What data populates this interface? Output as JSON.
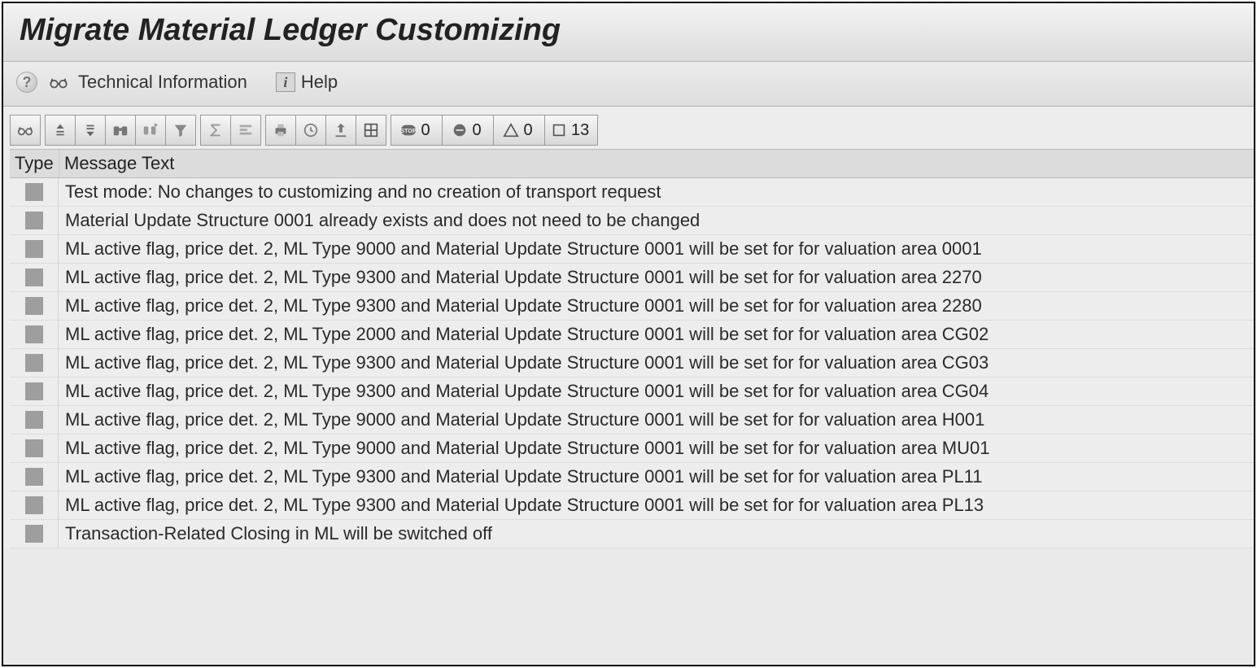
{
  "title": "Migrate Material Ledger Customizing",
  "subToolbar": {
    "techInfoLabel": "Technical Information",
    "helpLabel": "Help"
  },
  "alvCounts": {
    "stop": "0",
    "error": "0",
    "warning": "0",
    "info": "13"
  },
  "grid": {
    "headerType": "Type",
    "headerMessage": "Message Text",
    "rows": [
      {
        "text": "Test mode: No changes to customizing and no creation of transport request"
      },
      {
        "text": "Material Update Structure 0001 already exists and does not need to be changed"
      },
      {
        "text": "ML active flag, price det. 2, ML Type 9000 and Material Update Structure 0001 will be set for for valuation area 0001"
      },
      {
        "text": "ML active flag, price det. 2, ML Type 9300 and Material Update Structure 0001 will be set for for valuation area 2270"
      },
      {
        "text": "ML active flag, price det. 2, ML Type 9300 and Material Update Structure 0001 will be set for for valuation area 2280"
      },
      {
        "text": "ML active flag, price det. 2, ML Type 2000 and Material Update Structure 0001 will be set for for valuation area CG02"
      },
      {
        "text": "ML active flag, price det. 2, ML Type 9300 and Material Update Structure 0001 will be set for for valuation area CG03"
      },
      {
        "text": "ML active flag, price det. 2, ML Type 9300 and Material Update Structure 0001 will be set for for valuation area CG04"
      },
      {
        "text": "ML active flag, price det. 2, ML Type 9000 and Material Update Structure 0001 will be set for for valuation area H001"
      },
      {
        "text": "ML active flag, price det. 2, ML Type 9000 and Material Update Structure 0001 will be set for for valuation area MU01"
      },
      {
        "text": "ML active flag, price det. 2, ML Type 9300 and Material Update Structure 0001 will be set for for valuation area PL11"
      },
      {
        "text": "ML active flag, price det. 2, ML Type 9300 and Material Update Structure 0001 will be set for for valuation area PL13"
      },
      {
        "text": "Transaction-Related Closing in ML will be switched off"
      }
    ]
  }
}
